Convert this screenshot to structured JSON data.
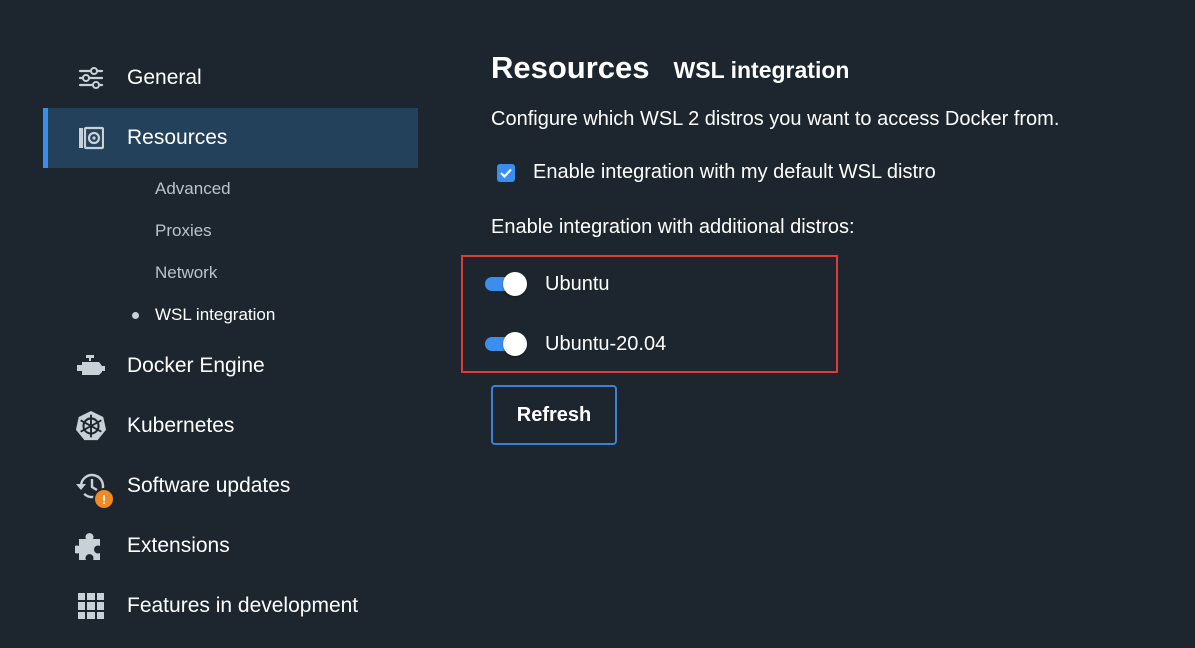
{
  "sidebar": {
    "items": [
      {
        "label": "General",
        "icon": "sliders-icon"
      },
      {
        "label": "Resources",
        "icon": "resources-icon",
        "active": true
      },
      {
        "label": "Docker Engine",
        "icon": "engine-icon"
      },
      {
        "label": "Kubernetes",
        "icon": "kubernetes-icon"
      },
      {
        "label": "Software updates",
        "icon": "history-icon",
        "badge": "!"
      },
      {
        "label": "Extensions",
        "icon": "puzzle-icon"
      },
      {
        "label": "Features in development",
        "icon": "grid-icon"
      }
    ],
    "sub_items": [
      {
        "label": "Advanced"
      },
      {
        "label": "Proxies"
      },
      {
        "label": "Network"
      },
      {
        "label": "WSL integration",
        "current": true
      }
    ]
  },
  "main": {
    "title": "Resources",
    "subtitle": "WSL integration",
    "description": "Configure which WSL 2 distros you want to access Docker from.",
    "default_distro": {
      "label": "Enable integration with my default WSL distro",
      "checked": true
    },
    "additional_label": "Enable integration with additional distros:",
    "distros": [
      {
        "name": "Ubuntu",
        "enabled": true
      },
      {
        "name": "Ubuntu-20.04",
        "enabled": true
      }
    ],
    "refresh_label": "Refresh"
  },
  "colors": {
    "background": "#1d262e",
    "active_item": "#24415c",
    "accent": "#3a8ef0",
    "highlight_box": "#e03a3a",
    "warning_badge": "#f08a24"
  }
}
